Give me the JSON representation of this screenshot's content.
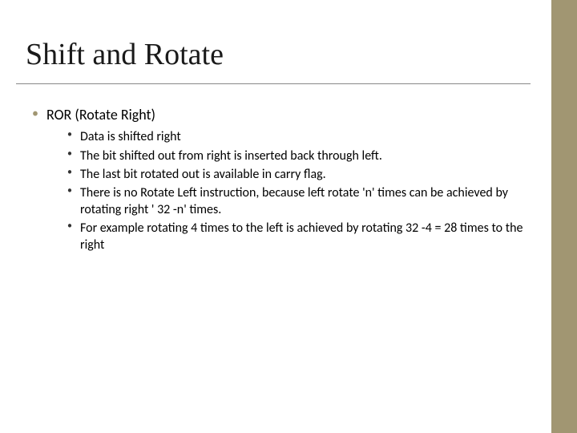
{
  "title": "Shift and Rotate",
  "bullets": {
    "l1": "ROR (Rotate Right)",
    "l2": [
      "Data is shifted right",
      "The bit shifted out from right is inserted back through left.",
      "The last bit rotated out is available in carry flag.",
      "There is no Rotate Left instruction, because left rotate  'n' times can be achieved by rotating right ' 32 -n' times.",
      "For example rotating 4 times to the left is achieved by rotating 32 -4 = 28 times to the right"
    ]
  }
}
